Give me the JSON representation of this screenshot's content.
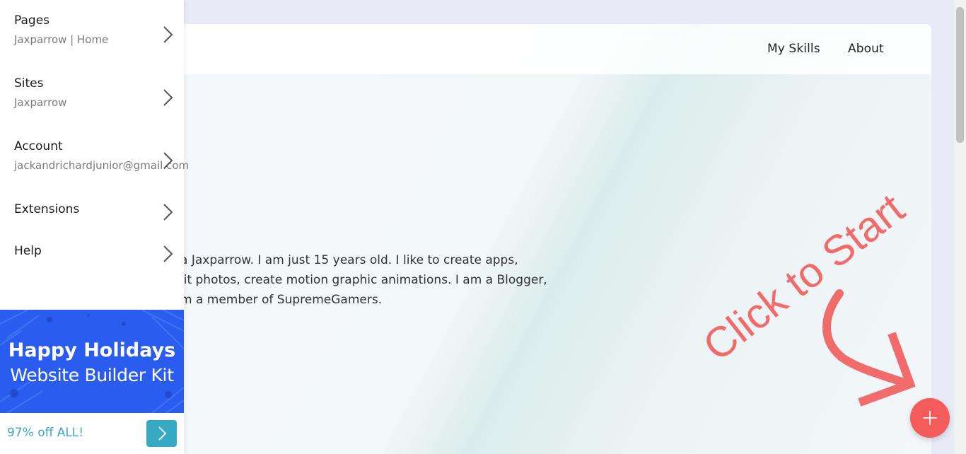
{
  "nav": {
    "links": [
      "My Skills",
      "About"
    ]
  },
  "hero": {
    "bio_lines": [
      "a Jaxparrow. I am just 15 years old. I like to create apps,",
      "lit photos, create motion graphic animations. I am a Blogger,",
      "m a member of SupremeGamers."
    ],
    "cta_text": "Click to Start"
  },
  "sidebar": {
    "items": [
      {
        "title": "Pages",
        "subtitle": "Jaxparrow | Home",
        "icon": "chevron-right-icon"
      },
      {
        "title": "Sites",
        "subtitle": "Jaxparrow",
        "icon": "chevron-right-icon"
      },
      {
        "title": "Account",
        "subtitle": "jackandrichardjunior@gmail.com",
        "icon": "chevron-right-icon"
      },
      {
        "title": "Extensions",
        "subtitle": "",
        "icon": "chevron-right-icon"
      },
      {
        "title": "Help",
        "subtitle": "",
        "icon": "chevron-right-icon"
      }
    ]
  },
  "promo": {
    "title": "Happy Holidays",
    "subtitle": "Website Builder Kit",
    "offer": "97% off ALL!",
    "go_icon": "chevron-right-icon"
  },
  "fab": {
    "icon": "plus-icon"
  },
  "colors": {
    "accent": "#f45b5b",
    "promo_blue": "#2b5cf0",
    "promo_teal": "#38a9c3"
  }
}
